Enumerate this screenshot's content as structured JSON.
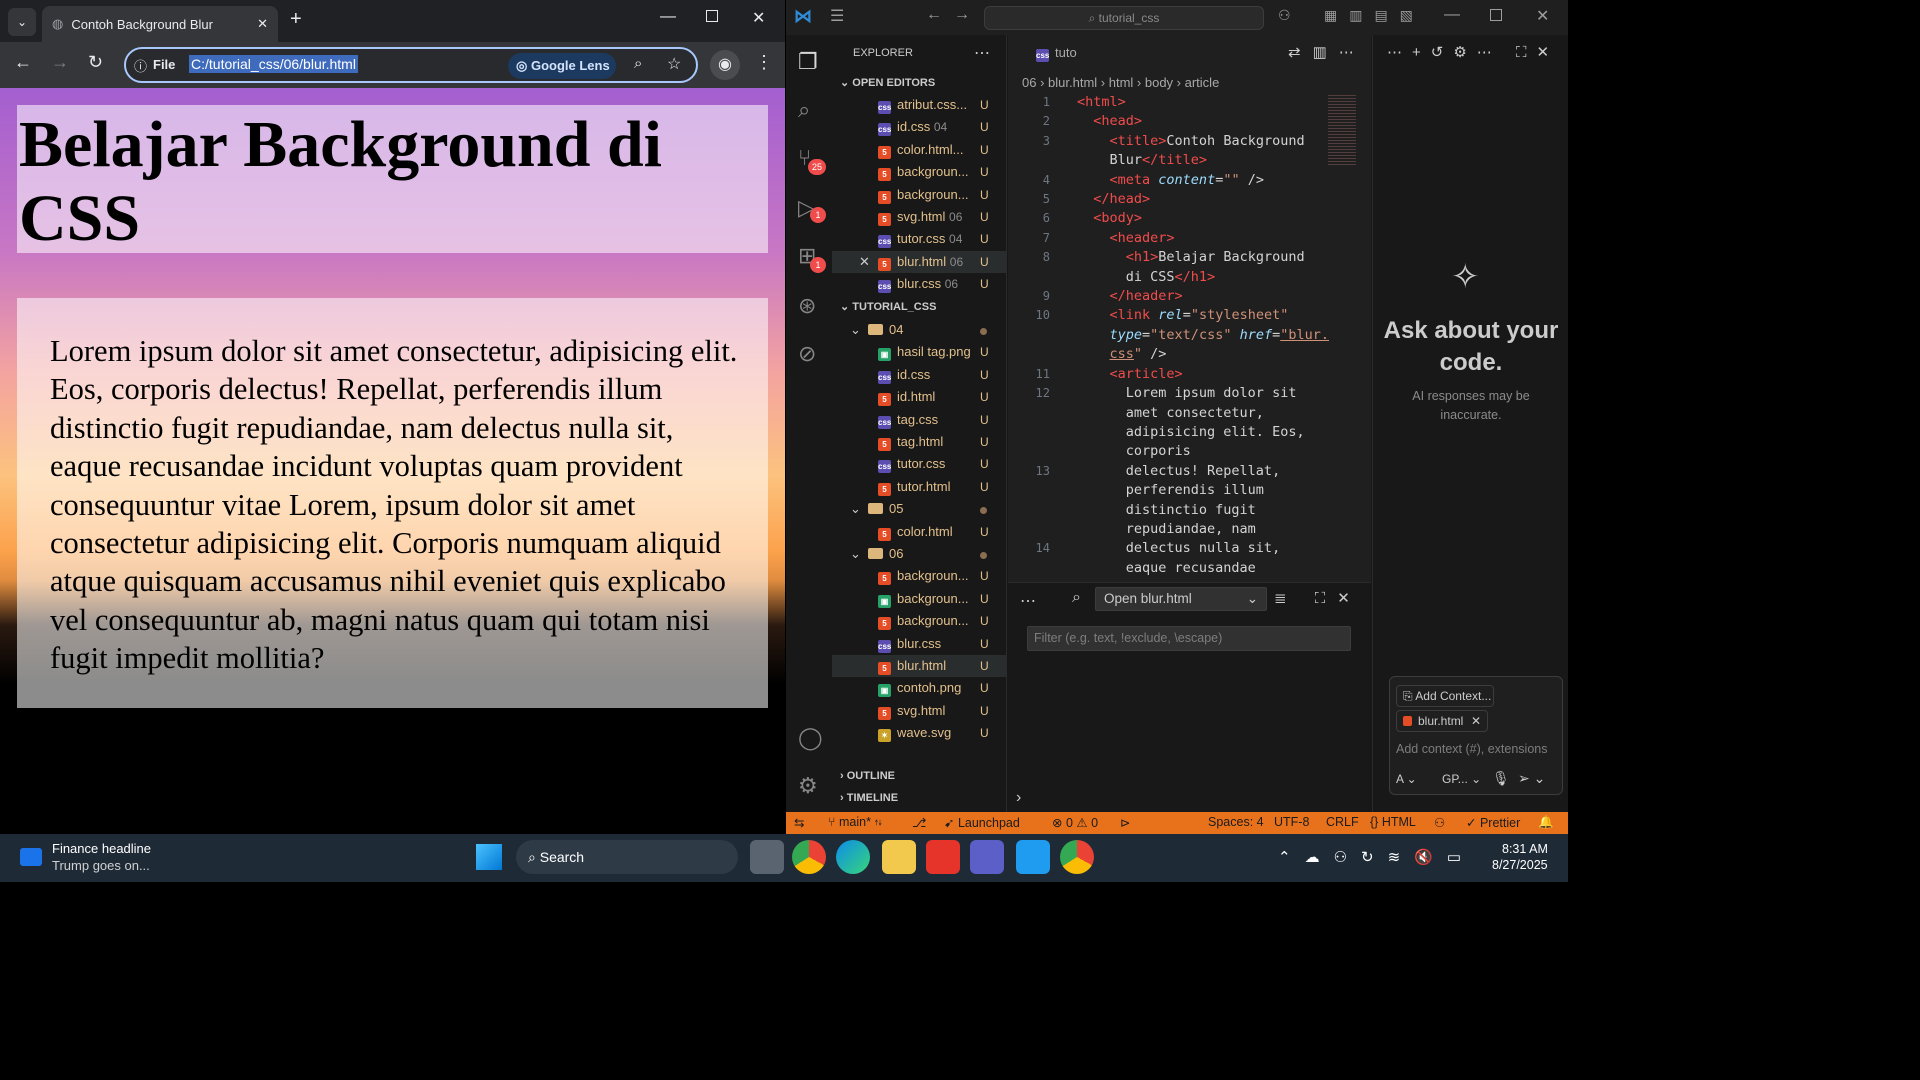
{
  "browser": {
    "tab_title": "Contoh Background Blur",
    "omnibox_scheme": "File",
    "url": "C:/tutorial_css/06/blur.html",
    "lens_label": "Google Lens",
    "page": {
      "heading": "Belajar Background di CSS",
      "article": "Lorem ipsum dolor sit amet consectetur, adipisicing elit. Eos, corporis delectus! Repellat, perferendis illum distinctio fugit repudiandae, nam delectus nulla sit, eaque recusandae incidunt voluptas quam provident consequuntur vitae Lorem, ipsum dolor sit amet consectetur adipisicing elit. Corporis numquam aliquid atque quisquam accusamus nihil eveniet quis explicabo vel consequuntur ab, magni natus quam qui totam nisi fugit impedit mollitia?"
    }
  },
  "vscode": {
    "search_placeholder": "tutorial_css",
    "explorer_title": "EXPLORER",
    "open_editors_title": "OPEN EDITORS",
    "open_editors": [
      {
        "name": "atribut.css...",
        "type": "css",
        "num": "",
        "status": "U"
      },
      {
        "name": "id.css",
        "type": "css",
        "num": "04",
        "status": "U"
      },
      {
        "name": "color.html...",
        "type": "html",
        "num": "",
        "status": "U"
      },
      {
        "name": "backgroun...",
        "type": "html",
        "num": "",
        "status": "U"
      },
      {
        "name": "backgroun...",
        "type": "html",
        "num": "",
        "status": "U"
      },
      {
        "name": "svg.html",
        "type": "html",
        "num": "06",
        "status": "U"
      },
      {
        "name": "tutor.css",
        "type": "css",
        "num": "04",
        "status": "U"
      },
      {
        "name": "blur.html",
        "type": "html",
        "num": "06",
        "status": "U"
      },
      {
        "name": "blur.css",
        "type": "css",
        "num": "06",
        "status": "U"
      }
    ],
    "folder_title": "TUTORIAL_CSS",
    "tree": [
      {
        "name": "04",
        "type": "folder",
        "depth": 1,
        "status": "dot"
      },
      {
        "name": "hasil tag.png",
        "type": "img",
        "depth": 2,
        "status": "U"
      },
      {
        "name": "id.css",
        "type": "css",
        "depth": 2,
        "status": "U"
      },
      {
        "name": "id.html",
        "type": "html",
        "depth": 2,
        "status": "U"
      },
      {
        "name": "tag.css",
        "type": "css",
        "depth": 2,
        "status": "U"
      },
      {
        "name": "tag.html",
        "type": "html",
        "depth": 2,
        "status": "U"
      },
      {
        "name": "tutor.css",
        "type": "css",
        "depth": 2,
        "status": "U"
      },
      {
        "name": "tutor.html",
        "type": "html",
        "depth": 2,
        "status": "U"
      },
      {
        "name": "05",
        "type": "folder",
        "depth": 1,
        "status": "dot"
      },
      {
        "name": "color.html",
        "type": "html",
        "depth": 2,
        "status": "U"
      },
      {
        "name": "06",
        "type": "folder",
        "depth": 1,
        "status": "dot"
      },
      {
        "name": "backgroun...",
        "type": "html",
        "depth": 2,
        "status": "U"
      },
      {
        "name": "backgroun...",
        "type": "img",
        "depth": 2,
        "status": "U"
      },
      {
        "name": "backgroun...",
        "type": "html",
        "depth": 2,
        "status": "U"
      },
      {
        "name": "blur.css",
        "type": "css",
        "depth": 2,
        "status": "U"
      },
      {
        "name": "blur.html",
        "type": "html",
        "depth": 2,
        "status": "U"
      },
      {
        "name": "contoh.png",
        "type": "img",
        "depth": 2,
        "status": "U"
      },
      {
        "name": "svg.html",
        "type": "html",
        "depth": 2,
        "status": "U"
      },
      {
        "name": "wave.svg",
        "type": "svg",
        "depth": 2,
        "status": "U"
      }
    ],
    "outline_title": "OUTLINE",
    "timeline_title": "TIMELINE",
    "editor_tab": "tuto",
    "breadcrumb": [
      "06",
      "blur.html",
      "html",
      "body",
      "article"
    ],
    "line_numbers": [
      "1",
      "2",
      "3",
      "",
      "4",
      "5",
      "6",
      "7",
      "8",
      "",
      "9",
      "10",
      "",
      "",
      "11",
      "12",
      "",
      "",
      "",
      "13",
      "",
      "",
      "",
      "14",
      ""
    ],
    "quick_open_value": "Open blur.html",
    "filter_placeholder": "Filter (e.g. text, !exclude, \\escape)",
    "chat": {
      "heading": "Ask about your code.",
      "note": "AI responses may be inaccurate.",
      "add_context": "Add Context...",
      "context_file": "blur.html",
      "input_placeholder": "Add context (#), extensions",
      "mode": "A",
      "model": "GP..."
    },
    "status": {
      "branch": "main*",
      "launchpad": "Launchpad",
      "errors": "0",
      "warnings": "0",
      "spaces": "Spaces: 4",
      "encoding": "UTF-8",
      "eol": "CRLF",
      "language": "HTML",
      "prettier": "Prettier"
    },
    "scm_badge": "25",
    "run_badge": "1",
    "ext_badge": "1"
  },
  "taskbar": {
    "news_title": "Finance headline",
    "news_sub": "Trump goes on...",
    "search": "Search",
    "time": "8:31 AM",
    "date": "8/27/2025"
  },
  "colors": {
    "accent": "#a8c7fa",
    "status_bar": "#e8711c",
    "untracked": "#e2c08d"
  }
}
